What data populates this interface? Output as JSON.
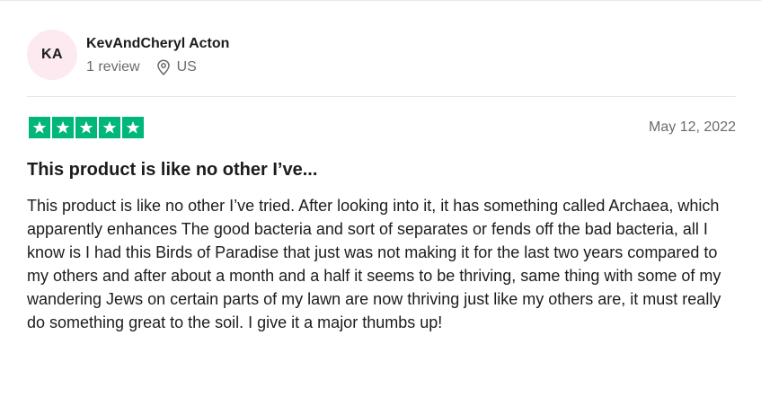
{
  "reviewer": {
    "initials": "KA",
    "name": "KevAndCheryl Acton",
    "review_count": "1 review",
    "location": "US",
    "location_icon": "location-pin-icon",
    "avatar_color": "#fde9f0"
  },
  "review": {
    "rating": 5,
    "rating_max": 5,
    "star_color": "#00b67a",
    "date": "May 12, 2022",
    "title": "This product is like no other I’ve...",
    "body": "This product is like no other I’ve tried. After looking into it, it has something called Archaea, which apparently enhances The good bacteria and sort of separates or fends off the bad bacteria, all I know is I had this Birds of Paradise that just was not making it for the last two years compared to my others and after about a month and a half it seems to be thriving, same thing with some of my wandering Jews on certain parts of my lawn are now thriving just like my others are, it must really do something great to the soil. I give it a major thumbs up!"
  }
}
